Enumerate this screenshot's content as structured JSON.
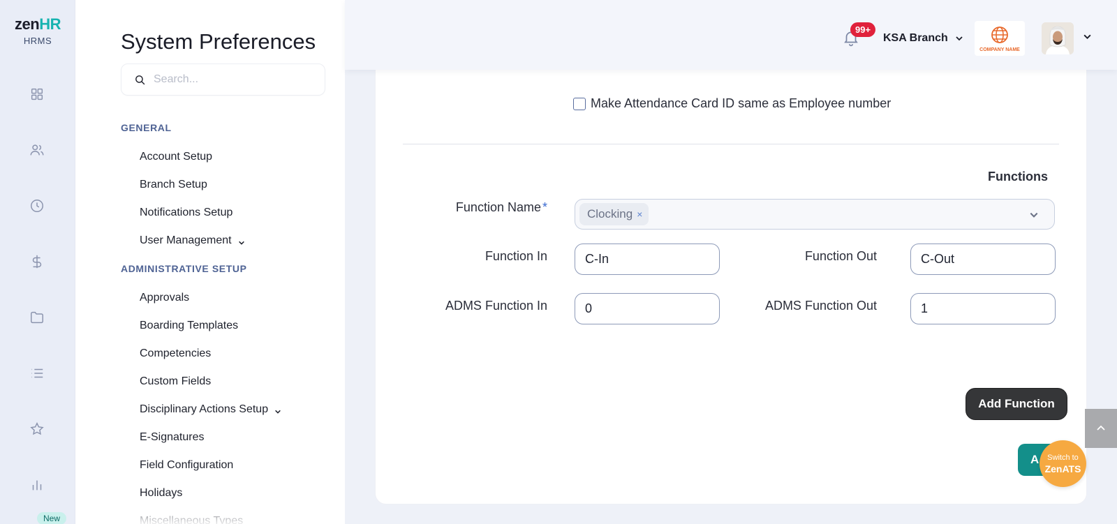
{
  "brand": {
    "logo_zen": "zen",
    "logo_hr": "HR",
    "logo_sub": "HRMS"
  },
  "rail": {
    "icons": [
      "dashboard-icon",
      "users-icon",
      "clock-icon",
      "dollar-icon",
      "folder-icon",
      "list-icon",
      "star-icon",
      "chart-icon"
    ],
    "new_badge": "New"
  },
  "settings": {
    "title": "System Preferences",
    "search_placeholder": "Search...",
    "sections": [
      {
        "heading": "GENERAL",
        "items": [
          "Account Setup",
          "Branch Setup",
          "Notifications Setup",
          "User Management"
        ]
      },
      {
        "heading": "ADMINISTRATIVE SETUP",
        "items": [
          "Approvals",
          "Boarding Templates",
          "Competencies",
          "Custom Fields",
          "Disciplinary Actions Setup",
          "E-Signatures",
          "Field Configuration",
          "Holidays",
          "Miscellaneous Types"
        ]
      }
    ]
  },
  "header": {
    "notifications_badge": "99+",
    "branch": "KSA Branch",
    "company_logo_text": "COMPANY NAME"
  },
  "form": {
    "checkbox_label": "Make Attendance Card ID same as Employee number",
    "checkbox_checked": false,
    "functions_title": "Functions",
    "function_name_label": "Function Name",
    "required_mark": "*",
    "function_name_tag": "Clocking",
    "tag_remove": "×",
    "function_in_label": "Function In",
    "function_in_value": "C-In",
    "function_out_label": "Function Out",
    "function_out_value": "C-Out",
    "adms_in_label": "ADMS Function In",
    "adms_in_value": "0",
    "adms_out_label": "ADMS Function Out",
    "adms_out_value": "1",
    "add_function_button": "Add Function",
    "partial_button": "A"
  },
  "floating": {
    "switch_line1": "Switch to",
    "switch_line2": "ZenATS"
  },
  "colors": {
    "accent": "#17b3b0",
    "teal_button": "#138f8a",
    "badge_red": "#e0213b",
    "zenats_orange": "#f6a941"
  }
}
